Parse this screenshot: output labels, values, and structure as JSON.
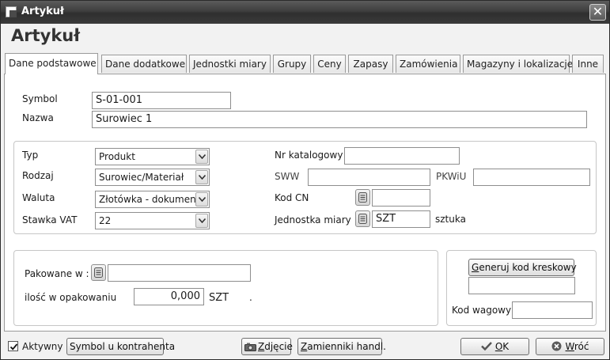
{
  "window": {
    "title": "Artykuł",
    "close_glyph": "✕"
  },
  "heading": "Artykuł",
  "tabs": [
    {
      "label": "Dane podstawowe",
      "active": true
    },
    {
      "label": "Dane dodatkowe"
    },
    {
      "label": "Jednostki miary"
    },
    {
      "label": "Grupy"
    },
    {
      "label": "Ceny"
    },
    {
      "label": "Zapasy"
    },
    {
      "label": "Zamówienia"
    },
    {
      "label": "Magazyny i lokalizacje"
    },
    {
      "label": "Inne"
    }
  ],
  "form": {
    "symbol": {
      "label": "Symbol",
      "value": "S-01-001"
    },
    "nazwa": {
      "label": "Nazwa",
      "value": "Surowiec 1"
    },
    "typ": {
      "label": "Typ",
      "value": "Produkt"
    },
    "rodzaj": {
      "label": "Rodzaj",
      "value": "Surowiec/Materiał"
    },
    "waluta": {
      "label": "Waluta",
      "value": "Złotówka - dokumen"
    },
    "stawka_vat": {
      "label": "Stawka VAT",
      "value": "22"
    },
    "nr_katalogowy": {
      "label": "Nr katalogowy",
      "value": ""
    },
    "sww": {
      "label": "SWW",
      "value": ""
    },
    "pkwiu": {
      "label": "PKWiU",
      "value": ""
    },
    "kod_cn": {
      "label": "Kod CN",
      "value": ""
    },
    "jednostka_miary": {
      "label": "Jednostka miary",
      "value": "SZT",
      "description": "sztuka"
    },
    "pakowane_w": {
      "label": "Pakowane w :",
      "value": ""
    },
    "ilosc_w_opakowaniu": {
      "label": "ilość w opakowaniu",
      "value": "0,000",
      "unit": "SZT",
      "dot": "."
    },
    "generuj_kod": {
      "label_underlined": "G",
      "label_rest": "eneruj kod kreskowy",
      "barcode_value": ""
    },
    "kod_wagowy": {
      "label": "Kod wagowy",
      "value": ""
    }
  },
  "bottom": {
    "aktywny": {
      "label": "Aktywny",
      "checked": true
    },
    "symbol_kontrahenta": "Symbol u kontrahenta",
    "zdjecie": {
      "underlined": "Z",
      "rest": "djęcie"
    },
    "zamienniki": {
      "underlined": "Z",
      "rest": "amienniki handl."
    },
    "ok": {
      "underlined": "O",
      "rest": "K"
    },
    "wroc": {
      "underlined": "W",
      "rest": "róć"
    }
  }
}
